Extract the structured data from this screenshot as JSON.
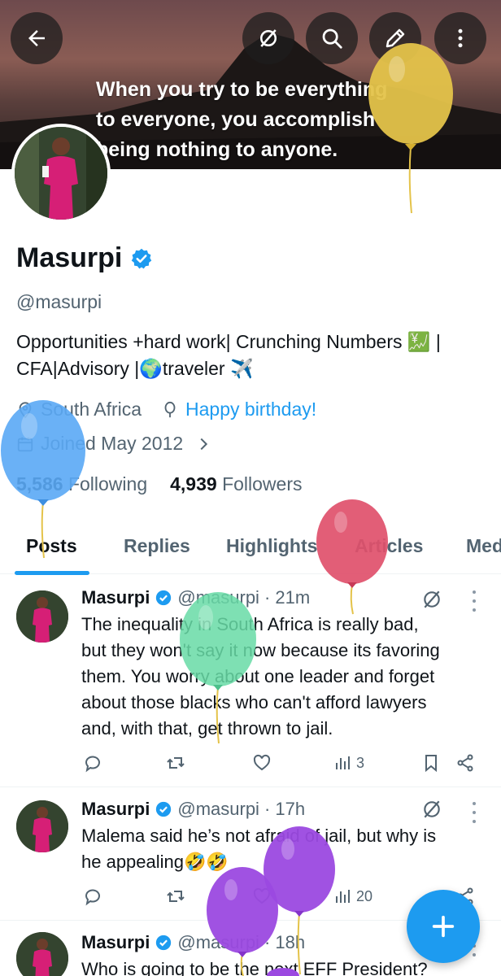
{
  "banner": {
    "quote_lines": [
      "When you try to be everything",
      "to everyone, you accomplish",
      "being nothing to anyone."
    ]
  },
  "profile": {
    "name": "Masurpi",
    "handle": "@masurpi",
    "bio_line1": "Opportunities +hard work| Crunching Numbers 💹 |",
    "bio_line2": "CFA|Advisory |🌍traveler ✈️",
    "location": "South Africa",
    "birthday": "Happy birthday!",
    "joined": "Joined May 2012",
    "following_count": "5,586",
    "following_label": "Following",
    "followers_count": "4,939",
    "followers_label": "Followers"
  },
  "tabs": [
    "Posts",
    "Replies",
    "Highlights",
    "Articles",
    "Media"
  ],
  "posts": [
    {
      "name": "Masurpi",
      "handle": "@masurpi",
      "time": "· 21m",
      "lines": [
        "The inequality in South Africa is really bad,",
        "but they won't say it now because its favoring",
        "them. You worry about one leader and forget",
        "about those blacks who can't afford lawyers",
        "and, with that, get thrown to jail."
      ],
      "views": "3"
    },
    {
      "name": "Masurpi",
      "handle": "@masurpi",
      "time": "· 17h",
      "lines": [
        "Malema said he’s not afraid of jail, but why is",
        "he appealing🤣🤣"
      ],
      "views": "20"
    },
    {
      "name": "Masurpi",
      "handle": "@masurpi",
      "time": "· 18h",
      "lines": [
        "Who is going to be the next EFF President?"
      ],
      "views": ""
    }
  ],
  "colors": {
    "accent": "#1d9bf0",
    "secondary_text": "#536471",
    "balloon_yellow": "#e4c34a",
    "balloon_blue": "#5aa9f5",
    "balloon_red": "#e0506b",
    "balloon_green": "#67dba6",
    "balloon_purple": "#9b49e0"
  },
  "icons": [
    "back-arrow-icon",
    "grok-icon",
    "search-icon",
    "edit-pencil-icon",
    "more-vertical-icon",
    "verified-badge-icon",
    "location-pin-icon",
    "birthday-balloon-icon",
    "calendar-icon",
    "chevron-right-icon",
    "reply-icon",
    "repost-icon",
    "like-icon",
    "views-icon",
    "bookmark-icon",
    "share-icon",
    "compose-plus-icon"
  ]
}
